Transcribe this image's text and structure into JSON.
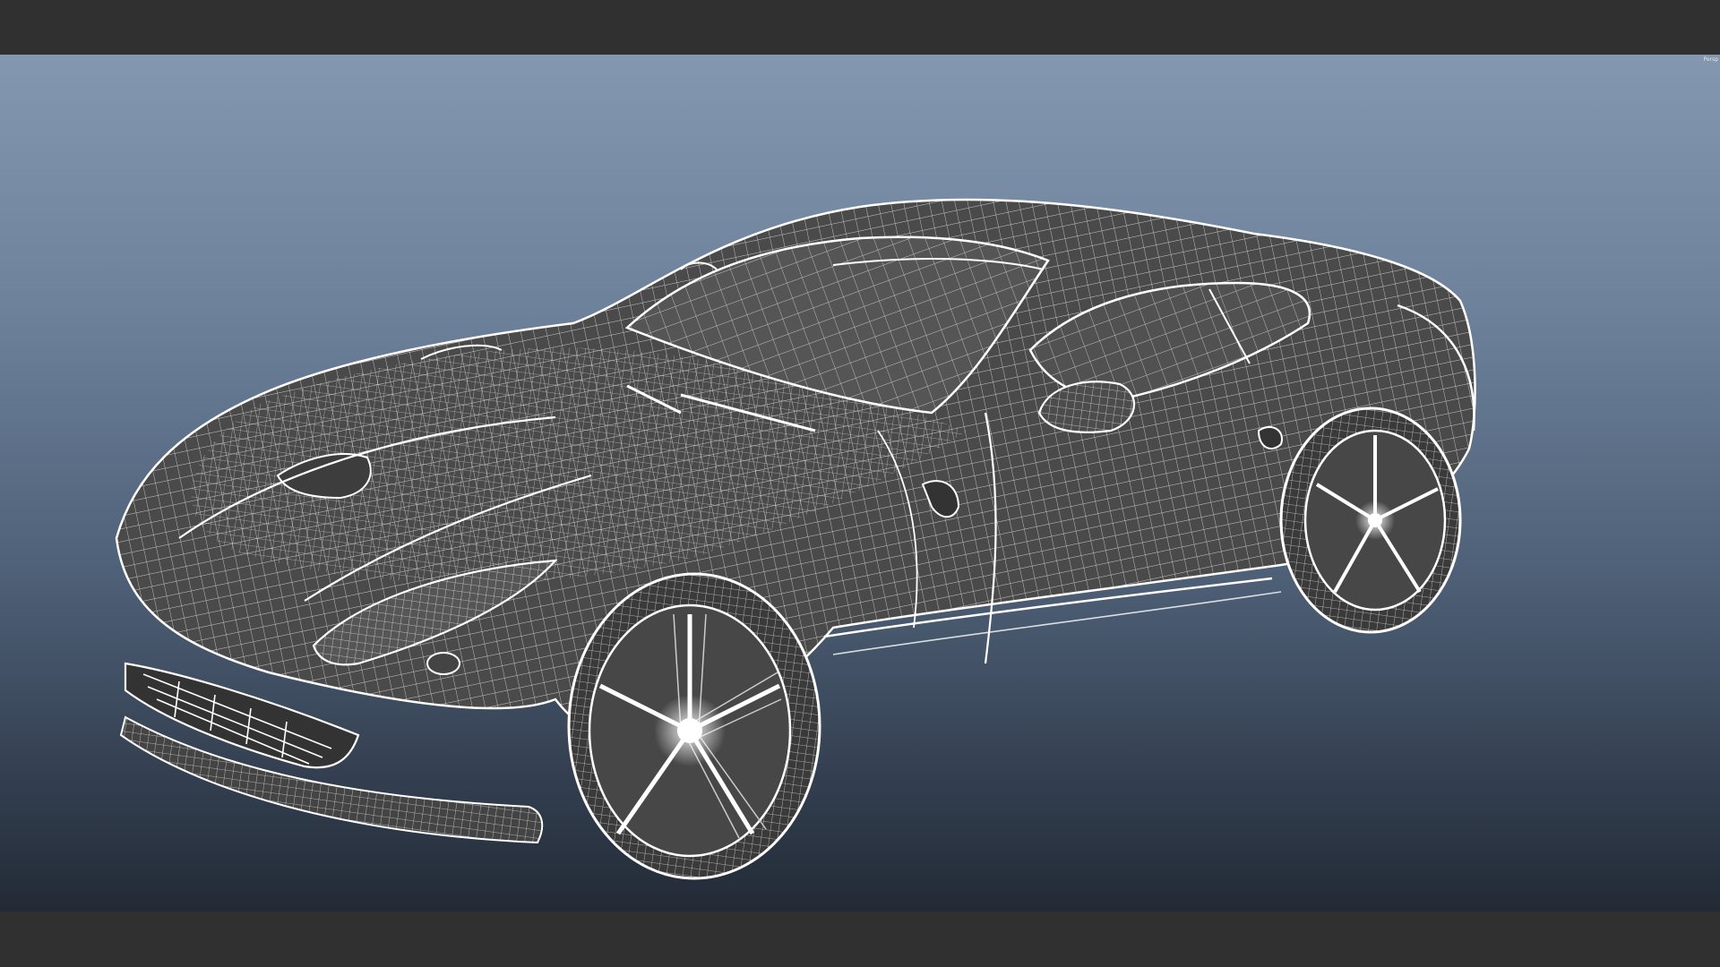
{
  "viewport": {
    "corner_label": "Persp",
    "shading_mode": "wireframe-on-shaded",
    "background_gradient": [
      "#8497b0",
      "#6d819b",
      "#4f6178",
      "#2f3a4a",
      "#222a35"
    ],
    "wire_color": "#ffffff",
    "body_color": "#4a4a4a"
  },
  "model": {
    "subject": "sports-car-wireframe"
  }
}
